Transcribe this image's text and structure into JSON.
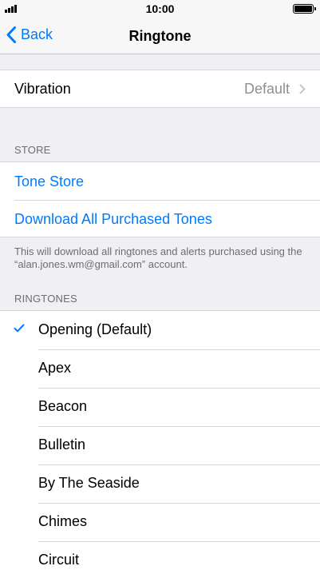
{
  "status_bar": {
    "time": "10:00"
  },
  "nav": {
    "back_label": "Back",
    "title": "Ringtone"
  },
  "vibration": {
    "label": "Vibration",
    "value": "Default"
  },
  "store": {
    "header": "STORE",
    "tone_store": "Tone Store",
    "download_all": "Download All Purchased Tones",
    "footer": "This will download all ringtones and alerts purchased using the “alan.jones.wm@gmail.com” account."
  },
  "ringtones": {
    "header": "RINGTONES",
    "items": [
      {
        "label": "Opening (Default)",
        "selected": true
      },
      {
        "label": "Apex",
        "selected": false
      },
      {
        "label": "Beacon",
        "selected": false
      },
      {
        "label": "Bulletin",
        "selected": false
      },
      {
        "label": "By The Seaside",
        "selected": false
      },
      {
        "label": "Chimes",
        "selected": false
      },
      {
        "label": "Circuit",
        "selected": false
      }
    ]
  },
  "colors": {
    "accent": "#007aff",
    "background": "#efeff4",
    "secondary_text": "#8e8e93"
  }
}
